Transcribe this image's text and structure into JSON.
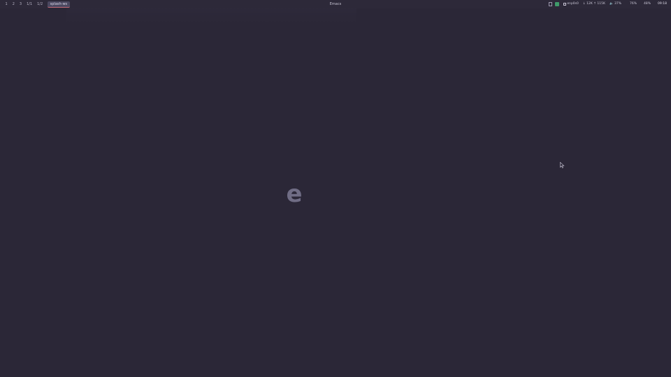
{
  "topbar": {
    "workspaces": [
      "1",
      "2",
      "3",
      "1/1",
      "1/2",
      "splash-ws"
    ],
    "active_workspace_index": 5,
    "window_title": "Emacs",
    "status": {
      "network_label": "enp0s0",
      "speed": "↓ 12K ↑ 115K",
      "volume": "🔈 37%",
      "cpu": "76%",
      "mem": "48%",
      "clock": "09:18"
    }
  },
  "splash": {
    "glyph": "e"
  },
  "colors": {
    "background": "#2b2737",
    "bar": "#2d2939",
    "accent": "#c46a78",
    "tray_green": "#3f9a6a"
  }
}
